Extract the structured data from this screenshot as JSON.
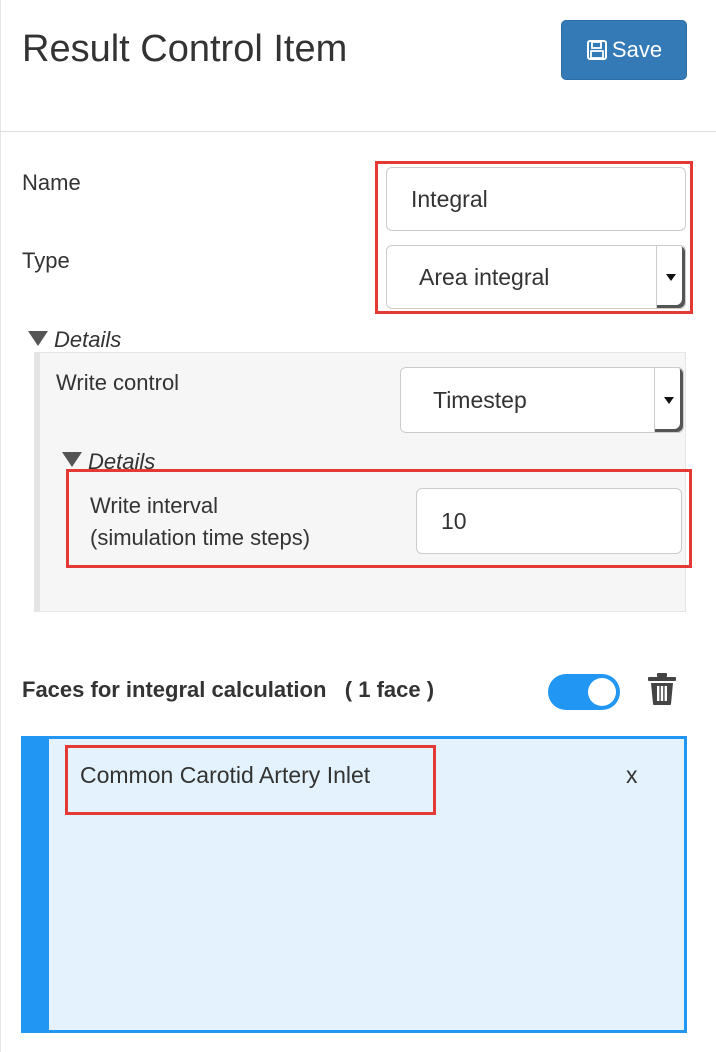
{
  "header": {
    "title": "Result Control Item",
    "save_label": "Save"
  },
  "form": {
    "name_label": "Name",
    "name_value": "Integral",
    "type_label": "Type",
    "type_value": "Area integral",
    "details_label": "Details",
    "write_control_label": "Write control",
    "write_control_value": "Timestep",
    "nested_details_label": "Details",
    "write_interval_label_line1": "Write interval",
    "write_interval_label_line2": "(simulation time steps)",
    "write_interval_value": "10"
  },
  "faces": {
    "heading": "Faces for integral calculation",
    "count": "( 1 face )",
    "toggle_on": true,
    "items": [
      {
        "label": "Common Carotid Artery Inlet",
        "remove": "x"
      }
    ]
  },
  "colors": {
    "accent": "#2196f3",
    "save_button": "#337ab7",
    "highlight": "#e53935",
    "list_background": "#e3f2fd"
  }
}
